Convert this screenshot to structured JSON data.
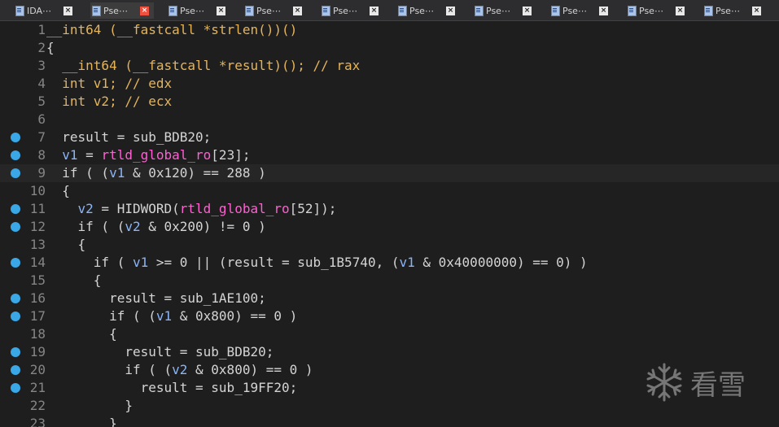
{
  "tabs": [
    {
      "label": "IDA⋯",
      "active": false
    },
    {
      "label": "Pse⋯",
      "active": true
    },
    {
      "label": "Pse⋯",
      "active": false
    },
    {
      "label": "Pse⋯",
      "active": false
    },
    {
      "label": "Pse⋯",
      "active": false
    },
    {
      "label": "Pse⋯",
      "active": false
    },
    {
      "label": "Pse⋯",
      "active": false
    },
    {
      "label": "Pse⋯",
      "active": false
    },
    {
      "label": "Pse⋯",
      "active": false
    },
    {
      "label": "Pse⋯",
      "active": false
    }
  ],
  "tab_close_glyph": "×",
  "colors": {
    "keyword": "#e5b45b",
    "global": "#ff5fd2",
    "variable": "#8ab4f8",
    "breakpoint": "#3aa8e6"
  },
  "lines": [
    {
      "n": 1,
      "bp": false,
      "tokens": [
        [
          "__int64 (__fastcall *strlen())()",
          "kw"
        ]
      ]
    },
    {
      "n": 2,
      "bp": false,
      "tokens": [
        [
          "{",
          ""
        ]
      ]
    },
    {
      "n": 3,
      "bp": false,
      "tokens": [
        [
          "  __int64 (__fastcall *result)(); // rax",
          "kw"
        ]
      ]
    },
    {
      "n": 4,
      "bp": false,
      "tokens": [
        [
          "  int v1; // edx",
          "kw"
        ]
      ]
    },
    {
      "n": 5,
      "bp": false,
      "tokens": [
        [
          "  int v2; // ecx",
          "kw"
        ]
      ]
    },
    {
      "n": 6,
      "bp": false,
      "tokens": []
    },
    {
      "n": 7,
      "bp": true,
      "tokens": [
        [
          "  result = sub_BDB20;",
          ""
        ]
      ]
    },
    {
      "n": 8,
      "bp": true,
      "tokens": [
        [
          "  ",
          ""
        ],
        [
          "v1",
          "var"
        ],
        [
          " = ",
          ""
        ],
        [
          "rtld_global_ro",
          "gl"
        ],
        [
          "[23];",
          ""
        ]
      ]
    },
    {
      "n": 9,
      "bp": true,
      "current": true,
      "tokens": [
        [
          "  if ( (",
          ""
        ],
        [
          "v1",
          "var"
        ],
        [
          " & 0x120) == 288 )",
          ""
        ]
      ]
    },
    {
      "n": 10,
      "bp": false,
      "tokens": [
        [
          "  {",
          ""
        ]
      ]
    },
    {
      "n": 11,
      "bp": true,
      "tokens": [
        [
          "    ",
          ""
        ],
        [
          "v2",
          "var"
        ],
        [
          " = HIDWORD(",
          ""
        ],
        [
          "rtld_global_ro",
          "gl"
        ],
        [
          "[52]);",
          ""
        ]
      ]
    },
    {
      "n": 12,
      "bp": true,
      "tokens": [
        [
          "    if ( (",
          ""
        ],
        [
          "v2",
          "var"
        ],
        [
          " & 0x200) != 0 )",
          ""
        ]
      ]
    },
    {
      "n": 13,
      "bp": false,
      "tokens": [
        [
          "    {",
          ""
        ]
      ]
    },
    {
      "n": 14,
      "bp": true,
      "tokens": [
        [
          "      if ( ",
          ""
        ],
        [
          "v1",
          "var"
        ],
        [
          " >= 0 || (result = sub_1B5740, (",
          ""
        ],
        [
          "v1",
          "var"
        ],
        [
          " & 0x40000000) == 0) )",
          ""
        ]
      ]
    },
    {
      "n": 15,
      "bp": false,
      "tokens": [
        [
          "      {",
          ""
        ]
      ]
    },
    {
      "n": 16,
      "bp": true,
      "tokens": [
        [
          "        result = sub_1AE100;",
          ""
        ]
      ]
    },
    {
      "n": 17,
      "bp": true,
      "tokens": [
        [
          "        if ( (",
          ""
        ],
        [
          "v1",
          "var"
        ],
        [
          " & 0x800) == 0 )",
          ""
        ]
      ]
    },
    {
      "n": 18,
      "bp": false,
      "tokens": [
        [
          "        {",
          ""
        ]
      ]
    },
    {
      "n": 19,
      "bp": true,
      "tokens": [
        [
          "          result = sub_BDB20;",
          ""
        ]
      ]
    },
    {
      "n": 20,
      "bp": true,
      "tokens": [
        [
          "          if ( (",
          ""
        ],
        [
          "v2",
          "var"
        ],
        [
          " & 0x800) == 0 )",
          ""
        ]
      ]
    },
    {
      "n": 21,
      "bp": true,
      "tokens": [
        [
          "            result = sub_19FF20;",
          ""
        ]
      ]
    },
    {
      "n": 22,
      "bp": false,
      "tokens": [
        [
          "          }",
          ""
        ]
      ]
    },
    {
      "n": 23,
      "bp": false,
      "tokens": [
        [
          "        }",
          ""
        ]
      ]
    }
  ],
  "watermark": {
    "label": "看雪",
    "icon": "snowflake-icon"
  }
}
